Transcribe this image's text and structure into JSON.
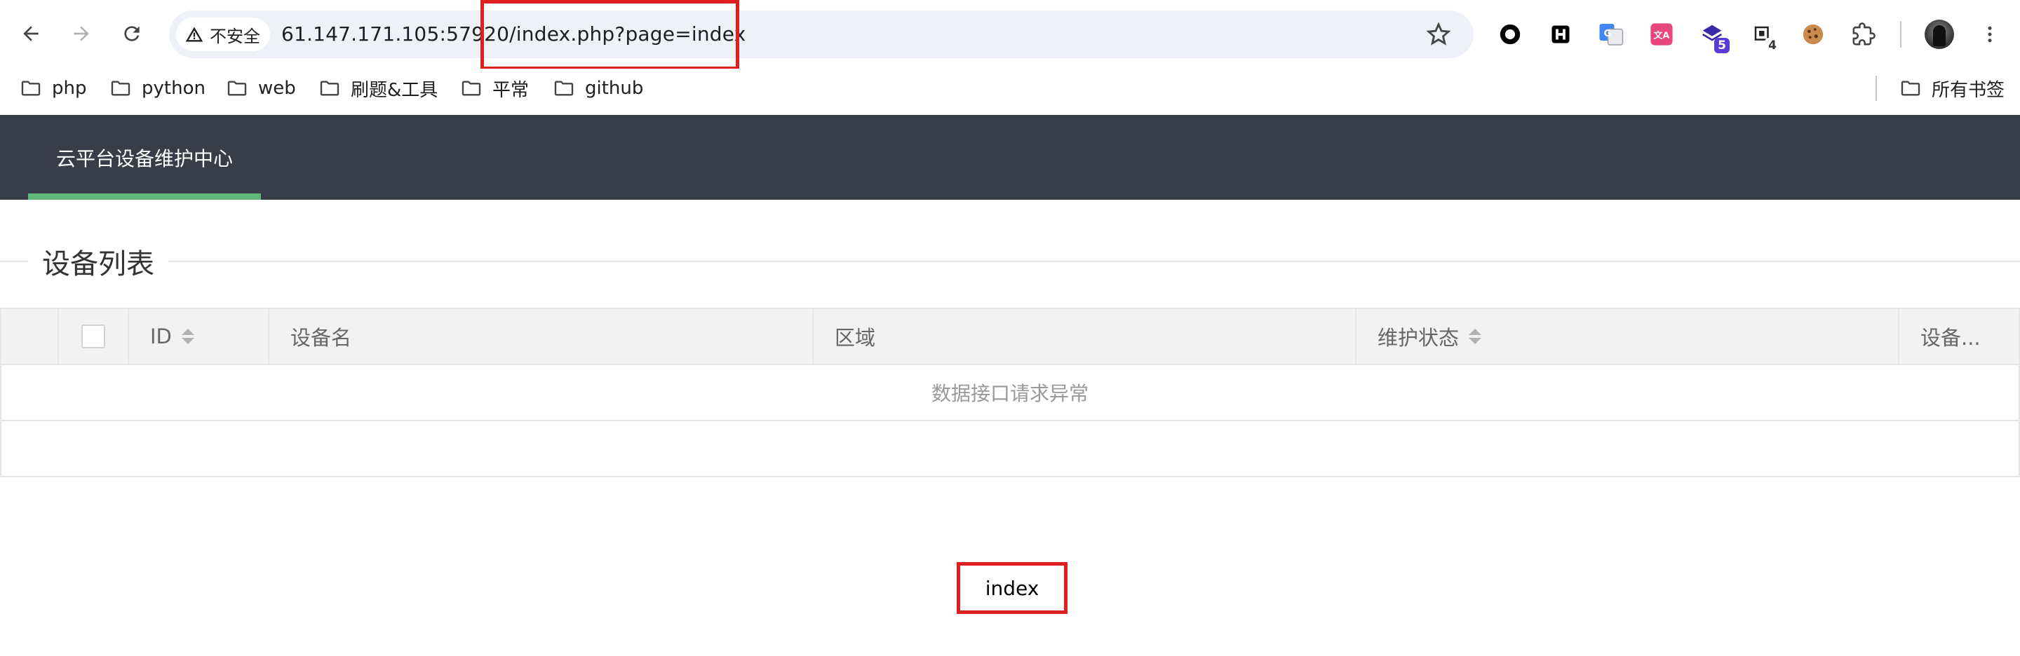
{
  "browser": {
    "security_label": "不安全",
    "url": "61.147.171.105:57920/index.php?page=index",
    "extensions": [
      {
        "icon": "circle-record-icon"
      },
      {
        "icon": "h-icon"
      },
      {
        "icon": "translate-icon"
      },
      {
        "icon": "zh-a-icon"
      },
      {
        "icon": "stack-icon",
        "badge": "5"
      },
      {
        "icon": "tab-icon",
        "badge": "4"
      },
      {
        "icon": "cookie-icon"
      },
      {
        "icon": "puzzle-icon"
      }
    ]
  },
  "bookmarks": {
    "items": [
      {
        "label": "php"
      },
      {
        "label": "python"
      },
      {
        "label": "web"
      },
      {
        "label": "刷题&工具"
      },
      {
        "label": "平常"
      },
      {
        "label": "github"
      }
    ],
    "all_bookmarks": "所有书签"
  },
  "app": {
    "nav_tab": "云平台设备维护中心",
    "accent_color": "#5fb878",
    "header_color": "#393d49"
  },
  "section": {
    "title": "设备列表"
  },
  "table": {
    "columns": [
      "",
      "",
      "ID",
      "设备名",
      "区域",
      "维护状态",
      "设备..."
    ],
    "empty_message": "数据接口请求异常"
  },
  "footer": {
    "text": "index"
  }
}
